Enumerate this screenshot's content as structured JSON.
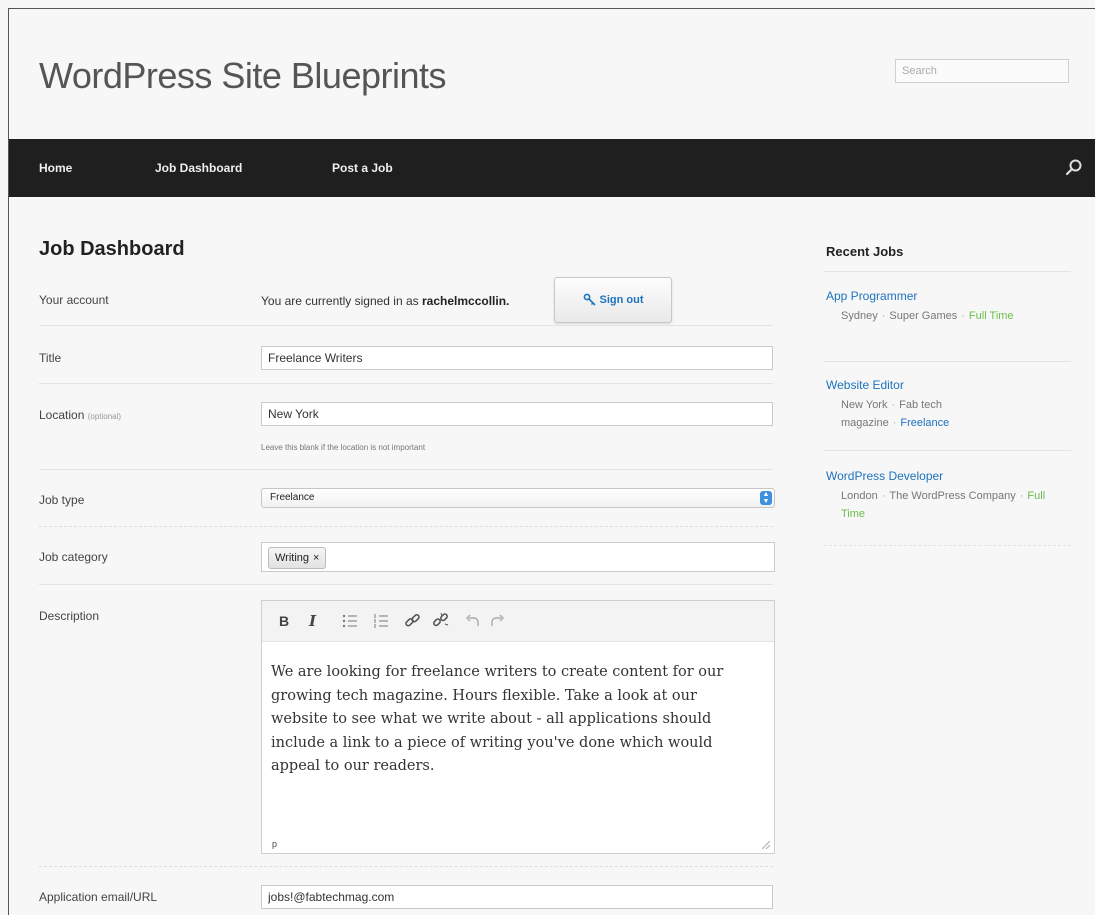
{
  "header": {
    "site_title": "WordPress Site Blueprints",
    "search_placeholder": "Search"
  },
  "nav": {
    "items": [
      {
        "label": "Home"
      },
      {
        "label": "Job Dashboard"
      },
      {
        "label": "Post a Job"
      }
    ],
    "search_icon": "search-icon"
  },
  "main": {
    "heading": "Job Dashboard",
    "account": {
      "label": "Your account",
      "signed_in_prefix": "You are currently signed in as ",
      "username": "rachelmccollin.",
      "signout_label": "Sign out",
      "signout_icon": "key-icon"
    },
    "title_field": {
      "label": "Title",
      "value": "Freelance Writers"
    },
    "location_field": {
      "label": "Location",
      "optional": "(optional)",
      "value": "New York",
      "hint": "Leave this blank if the location is not important"
    },
    "job_type": {
      "label": "Job type",
      "value": "Freelance"
    },
    "job_category": {
      "label": "Job category",
      "tags": [
        "Writing"
      ],
      "remove_glyph": "×"
    },
    "description": {
      "label": "Description",
      "toolbar": {
        "bold": "B",
        "italic": "I",
        "bullet_list_icon": "bullet-list-icon",
        "numbered_list_icon": "numbered-list-icon",
        "link_icon": "link-icon",
        "unlink_icon": "unlink-icon",
        "undo_icon": "undo-icon",
        "redo_icon": "redo-icon"
      },
      "text": "We are looking for freelance writers to create content for our growing tech magazine. Hours flexible. Take a look at our website to see what we write about - all applications should include a link to a piece of writing you've done which would appeal to our readers.",
      "path": "p"
    },
    "application": {
      "label": "Application email/URL",
      "value": "jobs!@fabtechmag.com"
    }
  },
  "sidebar": {
    "heading": "Recent Jobs",
    "separator": "·",
    "jobs": [
      {
        "title": "App Programmer",
        "location": "Sydney",
        "company": "Super Games",
        "type": "Full Time"
      },
      {
        "title": "Website Editor",
        "location": "New York",
        "company": "Fab tech magazine",
        "type": "Freelance"
      },
      {
        "title": "WordPress Developer",
        "location": "London",
        "company": "The WordPress Company",
        "type": "Full Time"
      }
    ]
  },
  "colors": {
    "link": "#1e73be",
    "full_time": "#6bbd4c",
    "navbar": "#1f1f1f"
  }
}
